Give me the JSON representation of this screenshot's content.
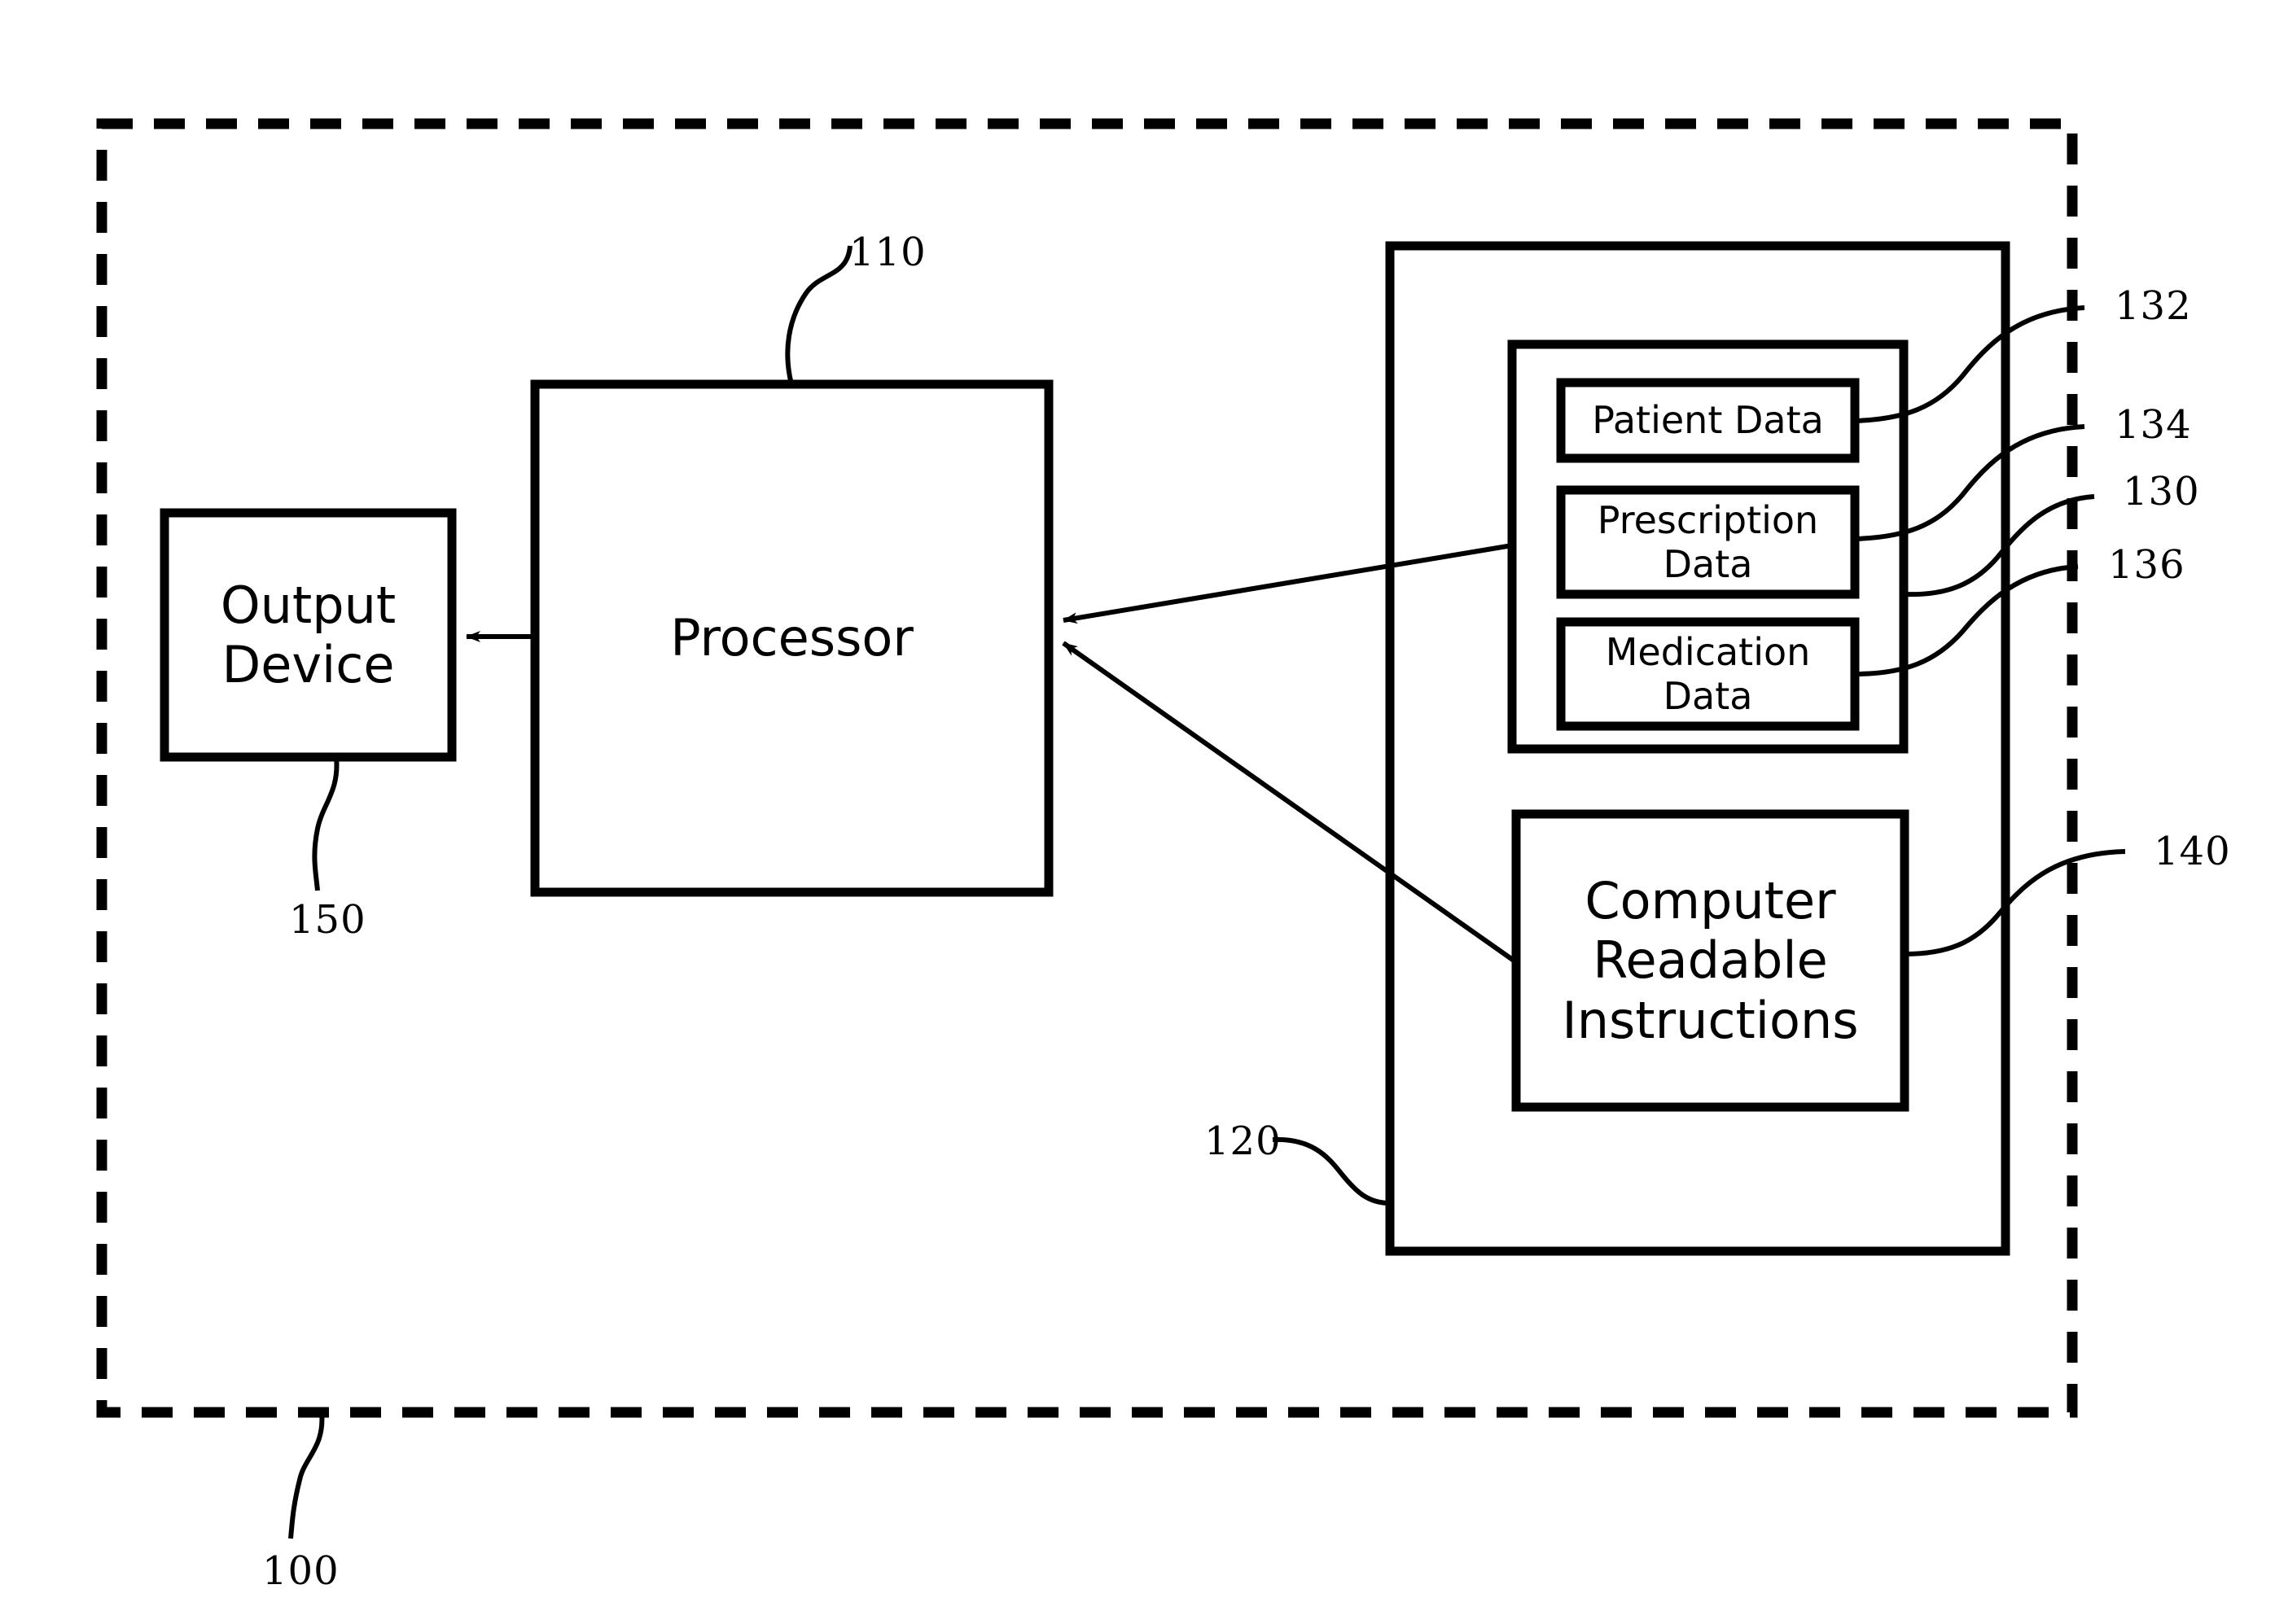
{
  "figure": {
    "type": "patent-block-diagram",
    "background_color": "#ffffff",
    "line_color": "#000000"
  },
  "blocks": {
    "system": {
      "name": "system-boundary",
      "style": "dashed",
      "ref": "100"
    },
    "output_device": {
      "label": "Output Device",
      "label_line1": "Output",
      "label_line2": "Device",
      "ref": "150"
    },
    "processor": {
      "label": "Processor",
      "ref": "110"
    },
    "memory": {
      "label": "",
      "ref": "120"
    },
    "database": {
      "label": "",
      "ref": "130"
    },
    "patient_data": {
      "label": "Patient Data",
      "ref": "132"
    },
    "prescription_data": {
      "label": "Prescription Data",
      "label_line1": "Prescription",
      "label_line2": "Data",
      "ref": "134"
    },
    "medication_data": {
      "label": "Medication Data",
      "label_line1": "Medication",
      "label_line2": "Data",
      "ref": "136"
    },
    "instructions": {
      "label": "Computer Readable Instructions",
      "label_line1": "Computer",
      "label_line2": "Readable",
      "label_line3": "Instructions",
      "ref": "140"
    }
  },
  "reference_numerals": [
    {
      "value": "110",
      "target": "processor"
    },
    {
      "value": "132",
      "target": "patient_data"
    },
    {
      "value": "134",
      "target": "prescription_data"
    },
    {
      "value": "130",
      "target": "database"
    },
    {
      "value": "136",
      "target": "medication_data"
    },
    {
      "value": "140",
      "target": "instructions"
    },
    {
      "value": "150",
      "target": "output_device"
    },
    {
      "value": "120",
      "target": "memory"
    },
    {
      "value": "100",
      "target": "system"
    }
  ]
}
